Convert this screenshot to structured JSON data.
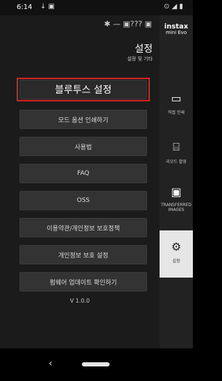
{
  "statusbar": {
    "time": "6:14",
    "icons_left": "↓ ▣",
    "icons_right": "⊙ ◢ ▮"
  },
  "header": {
    "icons": "✱ — ▣??? ▣",
    "title": "설정",
    "subtitle": "설정 및 기타"
  },
  "menu": {
    "bluetooth": "블루투스 설정",
    "mode_print": "모드 옵션 인쇄하기",
    "manual": "사용법",
    "faq": "FAQ",
    "oss": "OSS",
    "terms": "이용약관/개인정보 보호정책",
    "privacy": "개인정보 보호 설정",
    "firmware": "펌웨어 업데이트 확인하기"
  },
  "version": "V 1.0.0",
  "sidebar": {
    "brand": "instax",
    "brand_sub": "mini Evo",
    "items": [
      {
        "label": "직접 인쇄",
        "icon": "printer-icon"
      },
      {
        "label": "리모드 촬영",
        "icon": "remote-icon"
      },
      {
        "label": "TRANSFERRED IMAGES",
        "icon": "transfer-icon"
      },
      {
        "label": "설정",
        "icon": "gear-icon"
      }
    ]
  },
  "navbar": {
    "back": "‹"
  }
}
